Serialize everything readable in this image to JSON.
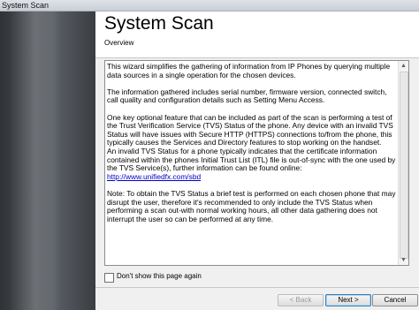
{
  "window": {
    "title": "System Scan"
  },
  "header": {
    "title": "System Scan",
    "subtitle": "Overview"
  },
  "body": {
    "p1": "This wizard simplifies the gathering of information from IP Phones by querying multiple data sources in a single operation for the chosen devices.",
    "p2": "The information gathered includes serial number, firmware version, connected switch, call quality and configuration details such as Setting Menu Access.",
    "p3": "One key optional feature that can be included as part of the scan is performing a test of the Trust Verification Service (TVS) Status of the phone. Any device with an invalid TVS Status will have issues with Secure HTTP (HTTPS) connections to/from the phone, this typically causes the Services and Directory features to stop working on the handset.",
    "p4": "An invalid TVS Status for a phone typically indicates that the certificate information contained within the phones Initial Trust List (ITL) file is out-of-sync with the one used by the TVS Service(s), further information can be found online:",
    "link": "http://www.unifiedfx.com/sbd",
    "p5": "Note: To obtain the TVS Status a brief test is performed on each chosen phone that may disrupt the user, therefore it's recommended to only include the TVS Status when performing a scan out-with normal working hours, all other data gathering does not interrupt the user so can be performed at any time."
  },
  "dont_show": {
    "label": "Don't show this page again",
    "checked": false
  },
  "buttons": {
    "back": "< Back",
    "next": "Next >",
    "cancel": "Cancel"
  }
}
